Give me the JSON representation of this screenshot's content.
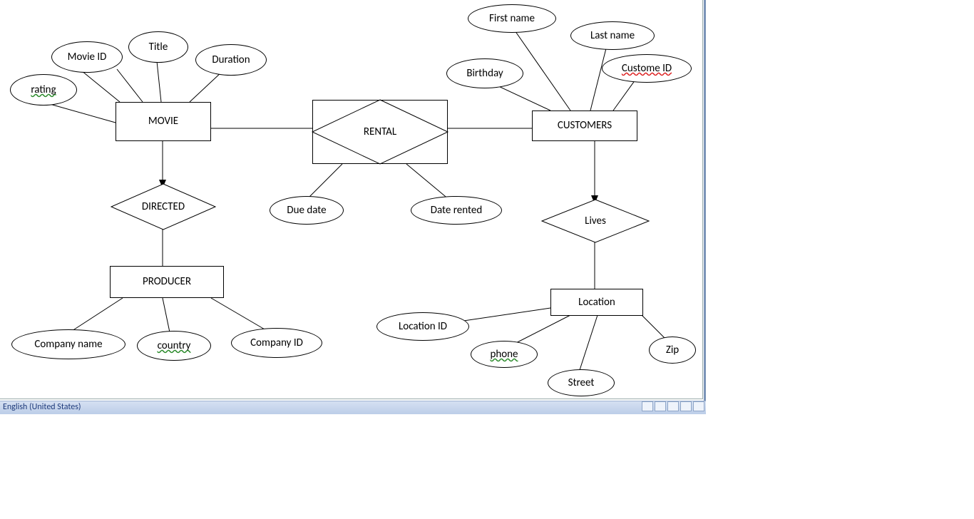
{
  "status": {
    "language": "English (United States)"
  },
  "entities": {
    "movie": {
      "label": "MOVIE",
      "attrs": {
        "movie_id": "Movie ID",
        "title": "Title",
        "duration": "Duration",
        "rating": "rating"
      }
    },
    "customers": {
      "label": "CUSTOMERS",
      "attrs": {
        "birthday": "Birthday",
        "first_name": "First name",
        "last_name": "Last name",
        "custome_id": "Custome ID"
      }
    },
    "producer": {
      "label": "PRODUCER",
      "attrs": {
        "company_name": "Company name",
        "country": "country",
        "company_id": "Company ID"
      }
    },
    "location": {
      "label": "Location",
      "attrs": {
        "location_id": "Location ID",
        "phone": "phone",
        "street": "Street",
        "zip": "Zip"
      }
    }
  },
  "relationships": {
    "rental": {
      "label": "RENTAL",
      "attrs": {
        "due_date": "Due date",
        "date_rented": "Date rented"
      }
    },
    "directed": {
      "label": "DIRECTED"
    },
    "lives": {
      "label": "Lives"
    }
  }
}
